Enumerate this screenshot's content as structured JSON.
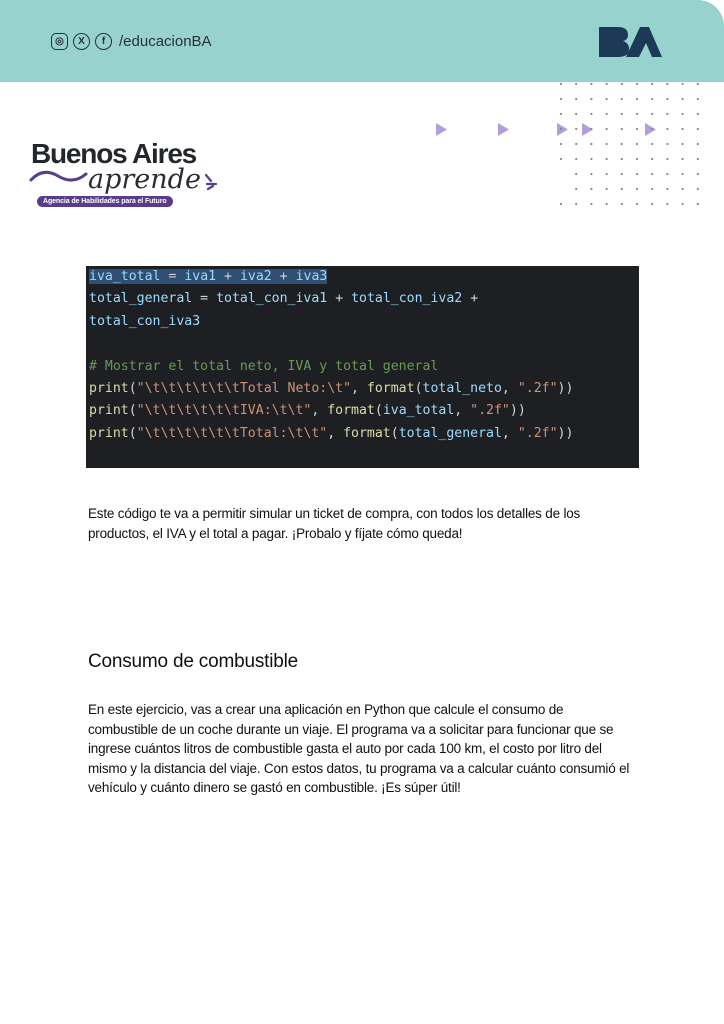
{
  "header": {
    "handle": "/educacionBA",
    "social_icons": [
      "instagram-icon",
      "x-icon",
      "facebook-icon"
    ],
    "brand_logo": "BA",
    "bg_color": "#98d2cf"
  },
  "logo": {
    "title": "Buenos Aires",
    "script": "aprende",
    "tagline": "Agencia de Habilidades para el Futuro",
    "tag_color": "#5a3c8c"
  },
  "code": {
    "lines": [
      "iva_total = iva1 + iva2 + iva3",
      "total_general = total_con_iva1 + total_con_iva2 +",
      "total_con_iva3",
      "",
      "# Mostrar el total neto, IVA y total general",
      "print(\"\\t\\t\\t\\t\\t\\tTotal Neto:\\t\", format(total_neto, \".2f\"))",
      "print(\"\\t\\t\\t\\t\\t\\tIVA:\\t\\t\", format(iva_total, \".2f\"))",
      "print(\"\\t\\t\\t\\t\\t\\tTotal:\\t\\t\", format(total_general, \".2f\"))"
    ],
    "background": "#1e1f22"
  },
  "body": {
    "paragraph1": "Este código te va a permitir simular un ticket de compra, con todos los detalles de los productos, el IVA y el total a pagar. ¡Probalo y fíjate cómo queda!",
    "heading": "Consumo de combustible",
    "paragraph2": "En este ejercicio, vas a crear una aplicación en Python que calcule el consumo de combustible de un coche durante un viaje. El programa va a solicitar para funcionar que se ingrese cuántos litros de combustible gasta el auto por cada 100 km, el costo por litro del mismo y la distancia del viaje. Con estos datos, tu programa va a calcular cuánto consumió el vehículo y cuánto dinero se gastó en combustible. ¡Es súper útil!"
  }
}
